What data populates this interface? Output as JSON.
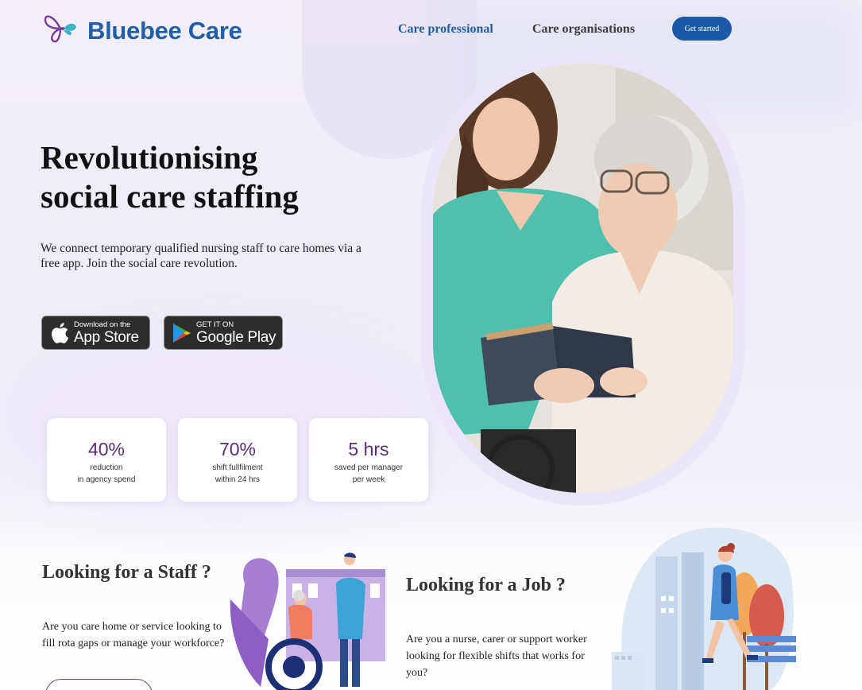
{
  "header": {
    "brand": "Bluebee Care",
    "nav": {
      "care_professional": "Care professional",
      "care_organisations": "Care organisations"
    },
    "cta": "Get started"
  },
  "hero": {
    "title_line1": "Revolutionising",
    "title_line2": "social care staffing",
    "subtitle": "We connect temporary qualified nursing staff to care homes via a free app. Join the social care revolution.",
    "appstore": {
      "small": "Download on the",
      "big": "App Store"
    },
    "playstore": {
      "small": "GET IT ON",
      "big": "Google Play"
    }
  },
  "stats": [
    {
      "value": "40%",
      "line1": "reduction",
      "line2": "in agency spend"
    },
    {
      "value": "70%",
      "line1": "shift fullfilment",
      "line2": "within 24 hrs"
    },
    {
      "value": "5 hrs",
      "line1": "saved per manager",
      "line2": "per week"
    }
  ],
  "staff_section": {
    "title": "Looking for a Staff ?",
    "text": "Are you care home or service looking to fill rota gaps or manage your workforce?"
  },
  "job_section": {
    "title": "Looking for a Job ?",
    "text": "Are you a nurse, carer or support worker looking for flexible shifts that works for you?"
  },
  "colors": {
    "brand": "#1e5fa8",
    "accent": "#5a2d7a",
    "cta_bg": "#1a5aa6"
  }
}
